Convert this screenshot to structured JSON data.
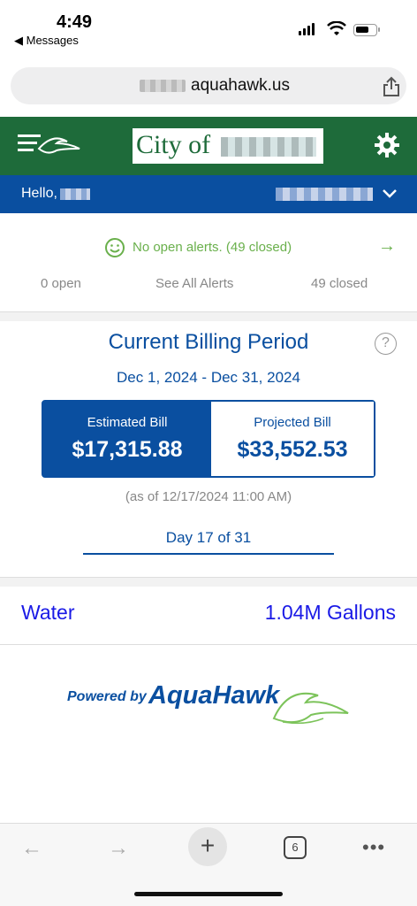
{
  "status_bar": {
    "time": "4:49",
    "back_app": "◀ Messages"
  },
  "browser": {
    "url": "aquahawk.us"
  },
  "header": {
    "city_prefix": "City of"
  },
  "account_bar": {
    "greeting": "Hello,"
  },
  "alerts": {
    "message": "No open alerts. (49 closed)",
    "open_label": "0 open",
    "see_all_label": "See All Alerts",
    "closed_label": "49 closed"
  },
  "billing": {
    "title": "Current Billing Period",
    "help": "?",
    "period": "Dec 1, 2024 - Dec 31, 2024",
    "estimated_label": "Estimated Bill",
    "estimated_value": "$17,315.88",
    "projected_label": "Projected Bill",
    "projected_value": "$33,552.53",
    "as_of": "(as of 12/17/2024 11:00 AM)",
    "day_progress": "Day 17 of 31"
  },
  "usage": {
    "label": "Water",
    "value": "1.04M Gallons"
  },
  "footer": {
    "powered_by": "Powered by",
    "brand": "AquaHawk"
  },
  "toolbar": {
    "back": "←",
    "forward": "→",
    "new_tab": "+",
    "tab_count": "6",
    "more": "•••"
  },
  "colors": {
    "green": "#1e6b3a",
    "blue": "#0a4fa0",
    "alert_green": "#6ab04c",
    "usage_blue": "#1a1ae6"
  },
  "icons": [
    "wifi-icon",
    "battery-icon",
    "share-icon",
    "menu-logo-icon",
    "gear-icon",
    "chevron-down-icon",
    "smile-icon",
    "arrow-right-icon",
    "help-icon",
    "hawk-logo-icon"
  ]
}
